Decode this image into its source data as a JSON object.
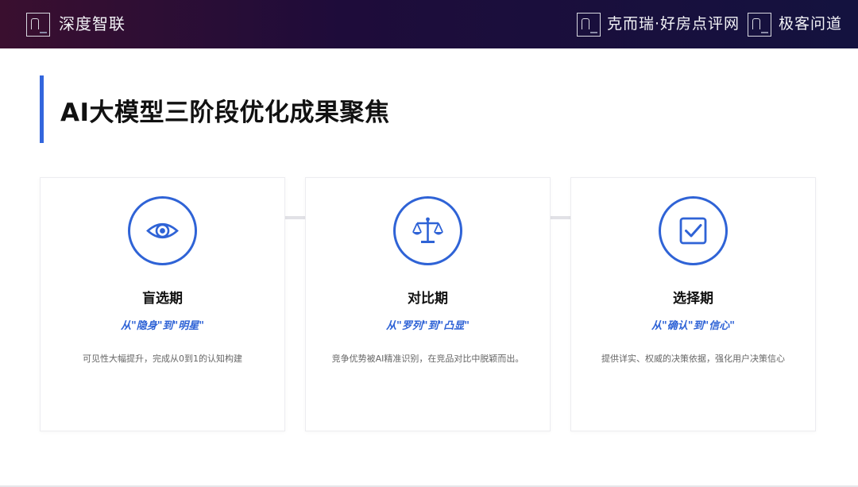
{
  "header": {
    "left_brand": "深度智联",
    "right_brand_1": "克而瑞·好房点评网",
    "right_brand_2": "极客问道"
  },
  "page_title": "AI大模型三阶段优化成果聚焦",
  "stages": [
    {
      "icon": "eye-icon",
      "title": "盲选期",
      "subtitle": "从\"隐身\"到\"明星\"",
      "description": "可见性大幅提升，完成从0到1的认知构建"
    },
    {
      "icon": "scale-icon",
      "title": "对比期",
      "subtitle": "从\"罗列\"到\"凸显\"",
      "description": "竞争优势被AI精准识别，在竞品对比中脱颖而出。"
    },
    {
      "icon": "checkbox-icon",
      "title": "选择期",
      "subtitle": "从\"确认\"到\"信心\"",
      "description": "提供详实、权威的决策依据，强化用户决策信心"
    }
  ],
  "colors": {
    "accent": "#2f63d6",
    "header_dark": "#1e0c3a"
  }
}
